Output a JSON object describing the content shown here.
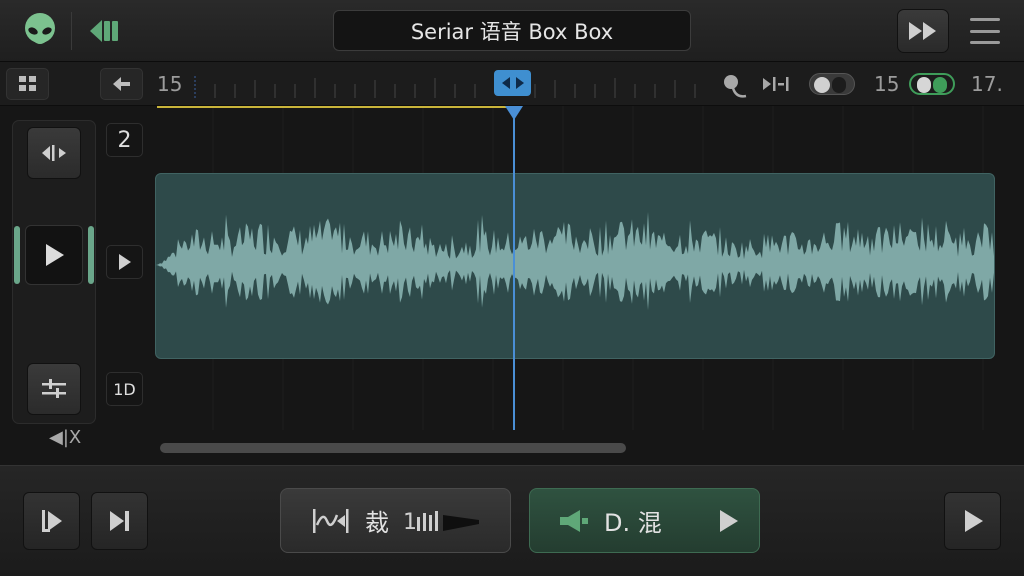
{
  "header": {
    "title": "Seriar 语音 Box Box"
  },
  "ruler": {
    "start_number": "15",
    "right_number_a": "15",
    "right_number_b": "17."
  },
  "left_panel": {
    "mute_label": "◀|X"
  },
  "track_side": {
    "track_count": "2",
    "zoom_label": "1D"
  },
  "bottom": {
    "trim_label": "裁",
    "mix_label": "D. 混"
  },
  "colors": {
    "accent_blue": "#4a8fd6",
    "waveform": "#7fa8a6",
    "region_fill": "#2e4a4a",
    "green_accent": "#5fa878",
    "yellow_marker": "#c9b43a"
  },
  "icons": {
    "app_logo": "alien-icon",
    "back": "back-arrow-icon",
    "fast_forward": "fast-forward-icon",
    "menu": "hamburger-menu-icon",
    "grid": "grid-icon",
    "mic": "microphone-icon",
    "snap": "snap-icon"
  }
}
